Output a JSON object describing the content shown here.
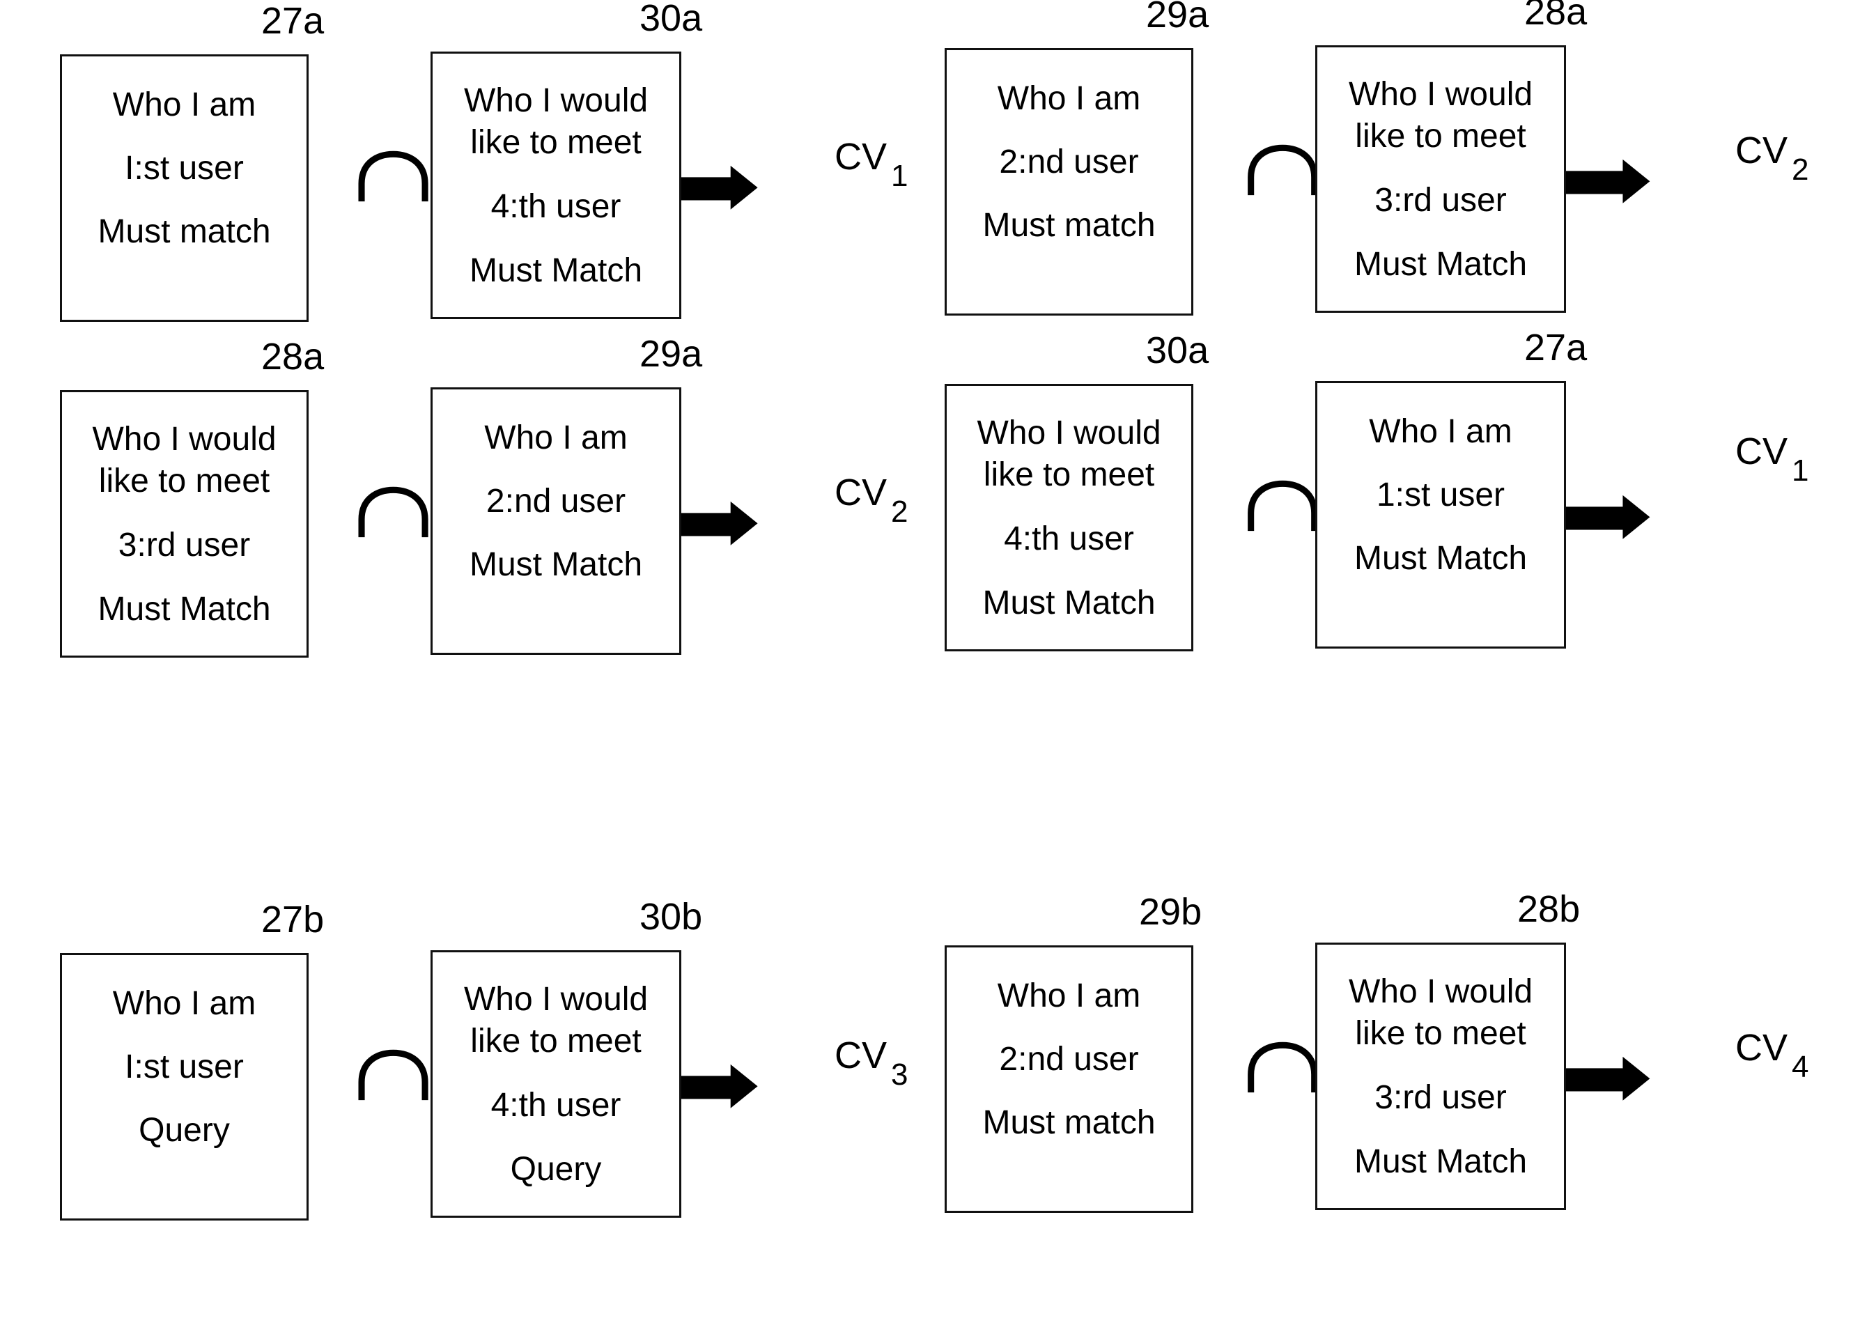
{
  "diagram": {
    "operator_symbol": "∩",
    "rows": [
      {
        "groups": [
          {
            "left": {
              "ref": "27a",
              "lines": [
                "Who I am",
                "I:st user",
                "Must match"
              ]
            },
            "right": {
              "ref": "30a",
              "lines": [
                "Who I would",
                "like to meet",
                "4:th user",
                "Must Match"
              ]
            },
            "result": {
              "base": "CV",
              "sub": "1"
            }
          },
          {
            "left": {
              "ref": "29a",
              "lines": [
                "Who I am",
                "2:nd user",
                "Must match"
              ]
            },
            "right": {
              "ref": "28a",
              "lines": [
                "Who I would",
                "like to meet",
                "3:rd user",
                "Must Match"
              ]
            },
            "result": {
              "base": "CV",
              "sub": "2"
            }
          }
        ]
      },
      {
        "groups": [
          {
            "left": {
              "ref": "28a",
              "lines": [
                "Who I would",
                "like to meet",
                "3:rd user",
                "Must Match"
              ]
            },
            "right": {
              "ref": "29a",
              "lines": [
                "Who I am",
                "2:nd user",
                "Must Match"
              ]
            },
            "result": {
              "base": "CV",
              "sub": "2"
            }
          },
          {
            "left": {
              "ref": "30a",
              "lines": [
                "Who I would",
                "like to meet",
                "4:th user",
                "Must Match"
              ]
            },
            "right": {
              "ref": "27a",
              "lines": [
                "Who I am",
                "1:st user",
                "Must Match"
              ]
            },
            "result": {
              "base": "CV",
              "sub": "1"
            }
          }
        ]
      },
      {
        "groups": [
          {
            "left": {
              "ref": "27b",
              "lines": [
                "Who I am",
                "I:st user",
                "Query"
              ]
            },
            "right": {
              "ref": "30b",
              "lines": [
                "Who I would",
                "like to meet",
                "4:th user",
                "Query"
              ]
            },
            "result": {
              "base": "CV",
              "sub": "3"
            }
          },
          {
            "left": {
              "ref": "29b",
              "lines": [
                "Who I am",
                "2:nd user",
                "Must match"
              ]
            },
            "right": {
              "ref": "28b",
              "lines": [
                "Who I would",
                "like to meet",
                "3:rd user",
                "Must Match"
              ]
            },
            "result": {
              "base": "CV",
              "sub": "4"
            }
          }
        ]
      }
    ]
  }
}
